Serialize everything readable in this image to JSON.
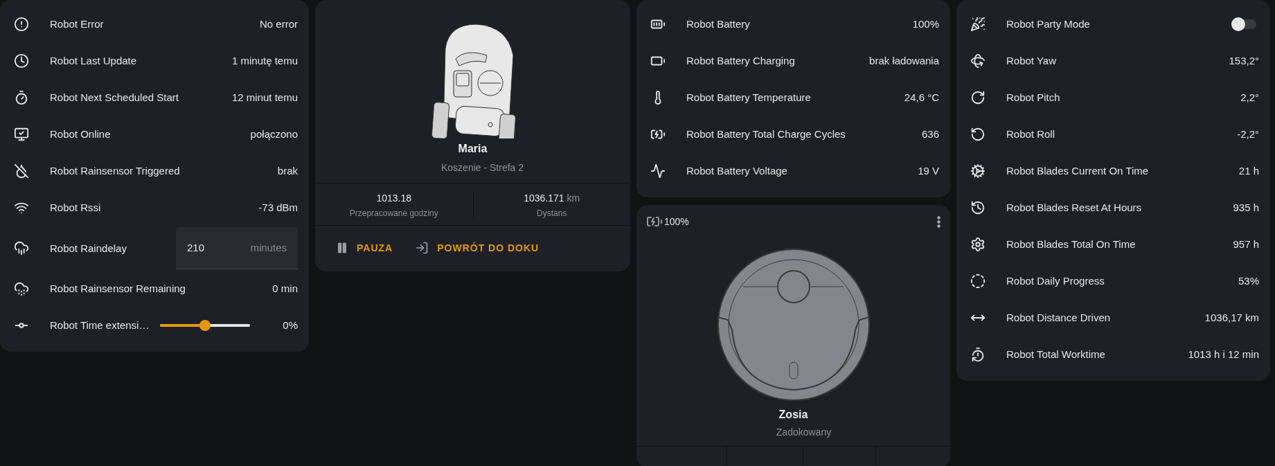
{
  "sensor_card": {
    "rows": [
      {
        "kind": "sensor",
        "label": "Robot Error",
        "value": "No error"
      },
      {
        "kind": "sensor",
        "label": "Robot Last Update",
        "value": "1 minutę temu"
      },
      {
        "kind": "sensor",
        "label": "Robot Next Scheduled Start",
        "value": "12 minut temu"
      },
      {
        "kind": "sensor",
        "label": "Robot Online",
        "value": "połączono"
      },
      {
        "kind": "sensor",
        "label": "Robot Rainsensor Triggered",
        "value": "brak"
      },
      {
        "kind": "sensor",
        "label": "Robot Rssi",
        "value": "-73 dBm"
      },
      {
        "kind": "number",
        "label": "Robot Raindelay",
        "value": "210",
        "unit": "minutes"
      },
      {
        "kind": "sensor",
        "label": "Robot Rainsensor Remaining",
        "value": "0 min"
      },
      {
        "kind": "slider",
        "label": "Robot Time extensi…",
        "level": 0.5,
        "value": "0%"
      }
    ]
  },
  "mower": {
    "name": "Maria",
    "status": "Koszenie - Strefa 2",
    "stats": [
      {
        "value": "1013.18",
        "label": "Przepracowane godziny"
      },
      {
        "value": "1036.171",
        "unit": "km",
        "label": "Dystans"
      }
    ],
    "actions": [
      {
        "kind": "pause",
        "label": "PAUZA"
      },
      {
        "kind": "dock",
        "label": "POWRÓT DO DOKU"
      }
    ]
  },
  "battery_card": {
    "rows": [
      {
        "kind": "sensor",
        "label": "Robot Battery",
        "value": "100%"
      },
      {
        "kind": "sensor",
        "label": "Robot Battery Charging",
        "value": "brak ładowania"
      },
      {
        "kind": "sensor",
        "label": "Robot Battery Temperature",
        "value": "24,6 °C"
      },
      {
        "kind": "sensor",
        "label": "Robot Battery Total Charge Cycles",
        "value": "636"
      },
      {
        "kind": "sensor",
        "label": "Robot Battery Voltage",
        "value": "19 V"
      }
    ]
  },
  "vacuum": {
    "battery": "100%",
    "name": "Zosia",
    "status": "Zadokowany"
  },
  "status_card": {
    "rows": [
      {
        "kind": "toggle",
        "label": "Robot Party Mode",
        "on": false
      },
      {
        "kind": "sensor",
        "label": "Robot Yaw",
        "value": "153,2°"
      },
      {
        "kind": "sensor",
        "label": "Robot Pitch",
        "value": "2,2°"
      },
      {
        "kind": "sensor",
        "label": "Robot Roll",
        "value": "-2,2°"
      },
      {
        "kind": "sensor",
        "label": "Robot Blades Current On Time",
        "value": "21 h"
      },
      {
        "kind": "sensor",
        "label": "Robot Blades Reset At Hours",
        "value": "935 h"
      },
      {
        "kind": "sensor",
        "label": "Robot Blades Total On Time",
        "value": "957 h"
      },
      {
        "kind": "sensor",
        "label": "Robot Daily Progress",
        "value": "53%"
      },
      {
        "kind": "sensor",
        "label": "Robot Distance Driven",
        "value": "1036,17 km"
      },
      {
        "kind": "sensor",
        "label": "Robot Total Worktime",
        "value": "1013 h i 12 min"
      }
    ]
  }
}
